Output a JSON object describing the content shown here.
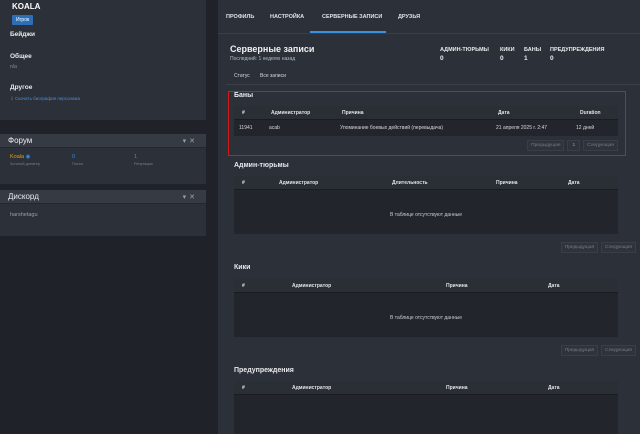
{
  "profile": {
    "username": "KOALA",
    "role": "Игрок",
    "badges_label": "Бейджи",
    "general_label": "Общее",
    "general_value": "n/a",
    "other_label": "Другое",
    "other_link": "Скачать биография персонажа"
  },
  "forum": {
    "title": "Форум",
    "name": "Koala",
    "name_sub": "Золотой донатер",
    "posts_value": "0",
    "posts_label": "Посты",
    "rep_value": "1",
    "rep_label": "Репутация"
  },
  "discord": {
    "title": "Дискорд",
    "value": "harshetagu"
  },
  "tabs": [
    "ПРОФИЛЬ",
    "НАСТРОЙКА",
    "СЕРВЕРНЫЕ ЗАПИСИ",
    "ДРУЗЬЯ"
  ],
  "records": {
    "title": "Серверные записи",
    "last": "Последний: 1 неделю назад",
    "stats": [
      {
        "label": "АДМИН-ТЮРЬМЫ",
        "value": "0"
      },
      {
        "label": "КИКИ",
        "value": "0"
      },
      {
        "label": "БАНЫ",
        "value": "1"
      },
      {
        "label": "ПРЕДУПРЕЖДЕНИЯ",
        "value": "0"
      }
    ],
    "subtabs": [
      "Статус",
      "Все записи"
    ]
  },
  "bans": {
    "title": "Баны",
    "headers": [
      "#",
      "Администратор",
      "Причина",
      "Дата",
      "Duration"
    ],
    "row": [
      "11941",
      "acab",
      "Упоминание боевых действий (перевыдача)",
      "21 апреля 2025 г. 2:47",
      "12 дней"
    ],
    "prev": "Предыдущая",
    "page": "1",
    "next": "Следующая"
  },
  "jails": {
    "title": "Админ-тюрьмы",
    "headers": [
      "#",
      "Администратор",
      "Длительность",
      "Причина",
      "Дата"
    ],
    "empty": "В таблице отсутствуют данные",
    "prev": "Предыдущая",
    "next": "Следующая"
  },
  "kicks": {
    "title": "Кики",
    "headers": [
      "#",
      "Администратор",
      "Причина",
      "Дата"
    ],
    "empty": "В таблице отсутствуют данные",
    "prev": "Предыдущая",
    "next": "Следующая"
  },
  "warnings": {
    "title": "Предупреждения",
    "headers": [
      "#",
      "Администратор",
      "Причина",
      "Дата"
    ]
  },
  "colors": {
    "accent": "#3a8fe0",
    "highlight": "#d01a1a",
    "role_badge": "#2d6fb7",
    "forum_name": "#e0a020"
  }
}
